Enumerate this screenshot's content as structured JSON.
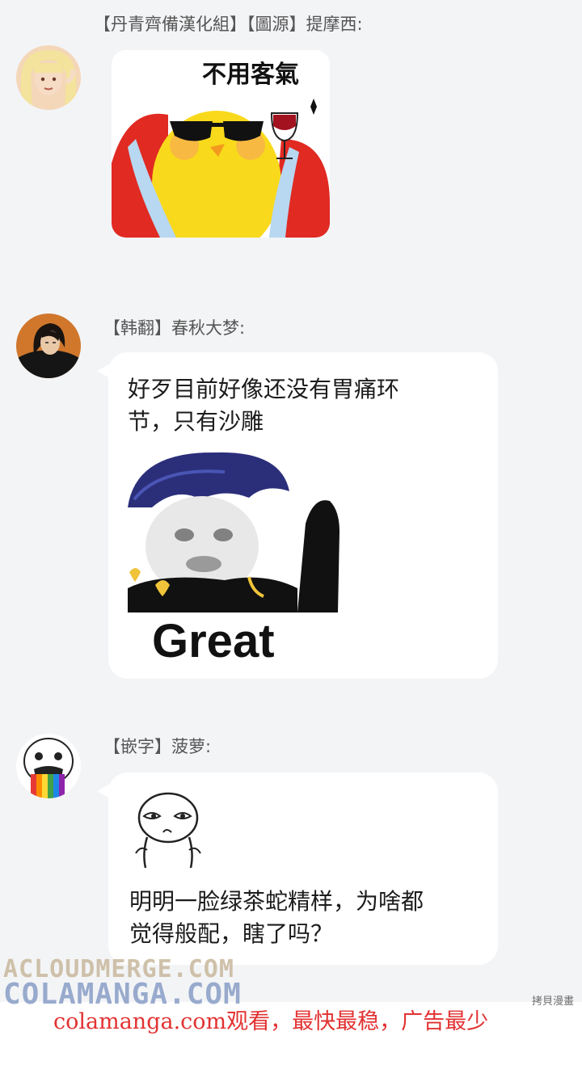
{
  "messages": [
    {
      "sender": "【丹青齊備漢化組】【圖源】提摩西:",
      "sticker_caption": "不用客氣"
    },
    {
      "sender": "【韩翻】春秋大梦:",
      "text_line1": "好歹目前好像还没有胃痛环",
      "text_line2": "节，只有沙雕",
      "sticker_caption": "Great"
    },
    {
      "sender": "【嵌字】菠萝:",
      "text_line1": "明明一脸绿茶蛇精样，为啥都",
      "text_line2": "觉得般配，瞎了吗？"
    }
  ],
  "watermark": {
    "line1": "ACLOUDMERGE.COM",
    "line2": "COLAMANGA.COM",
    "tiny": "拷貝漫畫"
  },
  "footer": {
    "text": "colamanga.com观看，最快最稳，广告最少"
  },
  "colors": {
    "background": "#f3f4f6",
    "bubble": "#ffffff",
    "footer": "#e23232"
  }
}
